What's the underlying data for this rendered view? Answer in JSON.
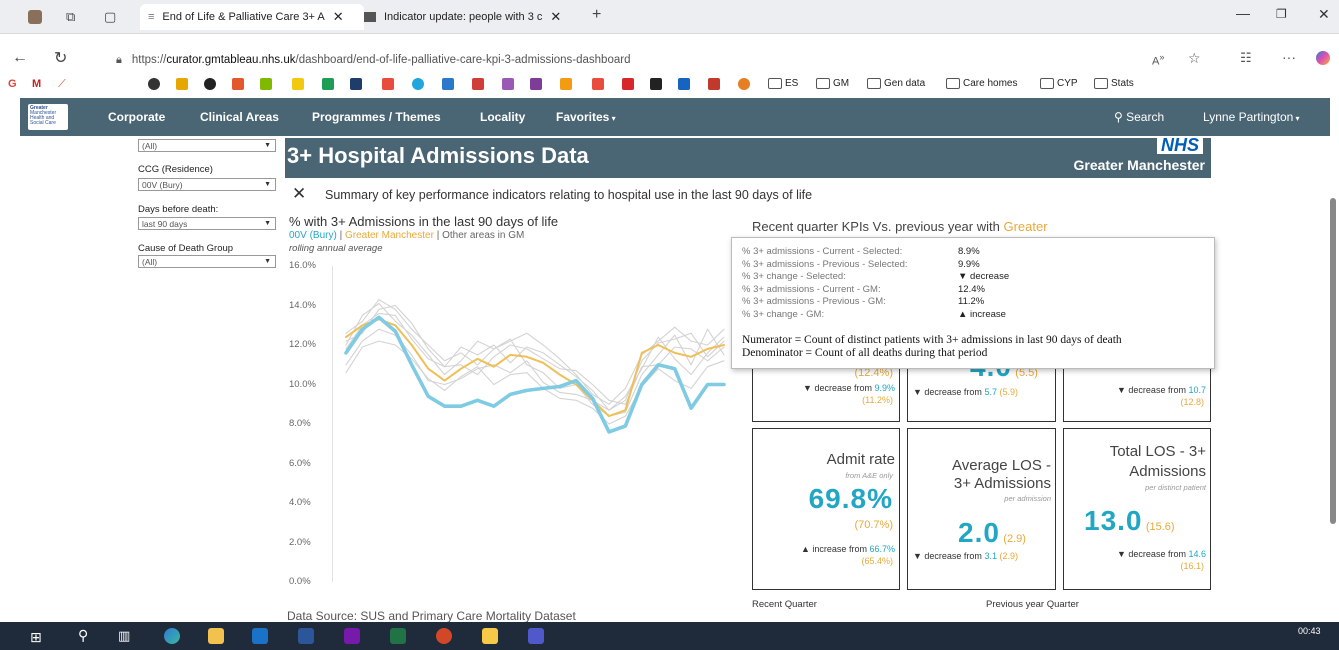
{
  "browser": {
    "tabs": [
      {
        "title": "End of Life & Palliative Care 3+ A"
      },
      {
        "title": "Indicator update: people with 3 c"
      }
    ],
    "url_prefix": "https://",
    "url_domain": "curator.gmtableau.nhs.uk",
    "url_path": "/dashboard/end-of-life-palliative-care-kpi-3-admissions-dashboard",
    "bookmarks": [
      "ES",
      "GM",
      "Gen data",
      "Care homes",
      "CYP",
      "Stats"
    ]
  },
  "nav": {
    "logo": "Greater Manchester Health and Social Care Partnership",
    "items": [
      "Corporate",
      "Clinical Areas",
      "Programmes / Themes",
      "Locality",
      "Favorites"
    ],
    "search": "Search",
    "user": "Lynne Partington"
  },
  "filters": {
    "top_value": "(All)",
    "ccg_label": "CCG (Residence)",
    "ccg_value": "00V (Bury)",
    "days_label": "Days before death:",
    "days_value": "last 90 days",
    "cause_label": "Cause of Death Group",
    "cause_value": "(All)"
  },
  "banner": {
    "title": "3+ Hospital Admissions Data",
    "nhs": "NHS",
    "org": "Greater Manchester"
  },
  "summary": "Summary of key performance indicators relating to hospital use in the last 90 days of life",
  "chart": {
    "title": "% with 3+ Admissions in the last 90 days of life",
    "legend_selected": "00V (Bury)",
    "legend_sep": "|",
    "legend_gm": "Greater Manchester",
    "legend_other": "Other areas in GM",
    "subtitle": "rolling annual average"
  },
  "chart_data": {
    "type": "line",
    "y_ticks": [
      "16.0%",
      "14.0%",
      "12.0%",
      "10.0%",
      "8.0%",
      "6.0%",
      "4.0%",
      "2.0%",
      "0.0%"
    ],
    "ylim": [
      0,
      16
    ],
    "series": [
      {
        "name": "00V (Bury)",
        "color": "#7ecbe3",
        "values": [
          11.6,
          12.8,
          13.4,
          12.7,
          11.0,
          9.4,
          8.9,
          8.9,
          9.2,
          8.9,
          9.5,
          9.7,
          9.8,
          9.9,
          10.2,
          9.3,
          7.6,
          7.9,
          10.0,
          11.0,
          10.8,
          8.8,
          10.0,
          10.0
        ]
      },
      {
        "name": "Greater Manchester",
        "color": "#f0bf55",
        "values": [
          12.4,
          13.0,
          13.3,
          13.0,
          12.0,
          10.8,
          10.2,
          10.8,
          11.3,
          10.9,
          11.5,
          11.4,
          11.1,
          10.5,
          10.0,
          9.2,
          8.4,
          8.7,
          11.6,
          12.0,
          11.6,
          11.4,
          11.8,
          12.0
        ]
      },
      {
        "name": "other-1",
        "color": "#d3d3d3",
        "values": [
          12.0,
          13.5,
          14.1,
          13.2,
          12.5,
          11.5,
          10.5,
          11.2,
          12.2,
          11.8,
          12.3,
          11.0,
          10.6,
          9.8,
          10.0,
          9.0,
          8.4,
          8.6,
          10.5,
          11.5,
          12.5,
          11.0,
          12.8,
          11.5
        ]
      },
      {
        "name": "other-2",
        "color": "#d3d3d3",
        "values": [
          11.0,
          12.2,
          12.8,
          12.5,
          11.5,
          10.2,
          10.0,
          10.3,
          10.8,
          11.0,
          10.6,
          11.2,
          10.1,
          9.6,
          9.5,
          9.2,
          8.7,
          9.4,
          10.8,
          12.4,
          11.3,
          10.5,
          11.6,
          12.4
        ]
      },
      {
        "name": "other-3",
        "color": "#d3d3d3",
        "values": [
          12.6,
          13.2,
          14.3,
          13.8,
          12.8,
          12.0,
          11.2,
          11.6,
          11.0,
          11.8,
          12.2,
          12.6,
          12.0,
          11.3,
          10.5,
          9.5,
          9.0,
          9.8,
          11.5,
          12.2,
          12.9,
          12.2,
          12.0,
          12.8
        ]
      },
      {
        "name": "other-4",
        "color": "#d3d3d3",
        "values": [
          10.6,
          11.9,
          12.2,
          12.0,
          11.3,
          10.3,
          9.7,
          10.4,
          10.9,
          10.0,
          10.5,
          10.6,
          9.8,
          9.3,
          9.2,
          8.8,
          8.0,
          8.4,
          9.9,
          10.8,
          10.2,
          9.8,
          10.9,
          11.2
        ]
      },
      {
        "name": "other-5",
        "color": "#d3d3d3",
        "values": [
          11.8,
          13.0,
          13.6,
          13.5,
          12.3,
          11.3,
          10.9,
          11.0,
          10.5,
          11.4,
          12.0,
          11.8,
          11.3,
          10.8,
          10.7,
          10.0,
          9.2,
          9.0,
          10.9,
          11.0,
          11.9,
          11.8,
          11.2,
          11.9
        ]
      },
      {
        "name": "other-6",
        "color": "#d3d3d3",
        "values": [
          12.2,
          12.6,
          13.8,
          14.0,
          13.1,
          11.8,
          10.9,
          11.9,
          11.5,
          12.0,
          11.1,
          11.9,
          11.6,
          11.0,
          10.4,
          9.7,
          8.7,
          9.2,
          11.2,
          12.1,
          12.3,
          12.6,
          11.4,
          12.2
        ]
      }
    ]
  },
  "kpi_section": {
    "title_main": "Recent quarter KPIs Vs. previous year with",
    "title_gm": "Greater",
    "footer_left": "Recent Quarter",
    "footer_right": "Previous year Quarter"
  },
  "tooltip": {
    "rows": [
      {
        "label": "% 3+ admissions - Current - Selected:",
        "value": "8.9%"
      },
      {
        "label": "% 3+ admissions - Previous - Selected:",
        "value": "9.9%"
      },
      {
        "label": "% 3+ change - Selected:",
        "value": "▼ decrease"
      },
      {
        "label": "% 3+ admissions - Current - GM:",
        "value": "12.4%"
      },
      {
        "label": "% 3+ admissions - Previous - GM:",
        "value": "11.2%"
      },
      {
        "label": "% 3+ change - GM:",
        "value": "▲ increase"
      }
    ],
    "numerator": "Numerator = Count of distinct patients with 3+ admissions in last 90 days of death",
    "denominator": "Denominator = Count of all deaths during that period"
  },
  "kpis_top": [
    {
      "prev": "(12.4%)",
      "chg_text": "▼ decrease from",
      "chg_val": "9.9%",
      "chg_prev": "(11.2%)"
    },
    {
      "value": "4.0",
      "prev": "(5.5)",
      "chg_text": "▼ decrease from",
      "chg_val": "5.7",
      "chg_prev": "(5.9)"
    },
    {
      "chg_text": "▼ decrease from",
      "chg_val": "10.7",
      "chg_prev": "(12.8)"
    }
  ],
  "kpis_bottom": [
    {
      "name": "Admit rate",
      "sub": "from A&E only",
      "value": "69.8%",
      "prev": "(70.7%)",
      "chg_text": "▲ increase from",
      "chg_val": "66.7%",
      "chg_prev": "(65.4%)"
    },
    {
      "name1": "Average LOS -",
      "name2": "3+ Admissions",
      "sub": "per admission",
      "value": "2.0",
      "prev": "(2.9)",
      "chg_text": "▼ decrease from",
      "chg_val": "3.1",
      "chg_prev": "(2.9)"
    },
    {
      "name1": "Total LOS - 3+",
      "name2": "Admissions",
      "sub": "per distinct patient",
      "value": "13.0",
      "prev": "(15.6)",
      "chg_text": "▼ decrease from",
      "chg_val": "14.6",
      "chg_prev": "(16.1)"
    }
  ],
  "datasource": "Data Source: SUS and Primary Care Mortality Dataset",
  "taskbar": {
    "time": "00:43"
  }
}
